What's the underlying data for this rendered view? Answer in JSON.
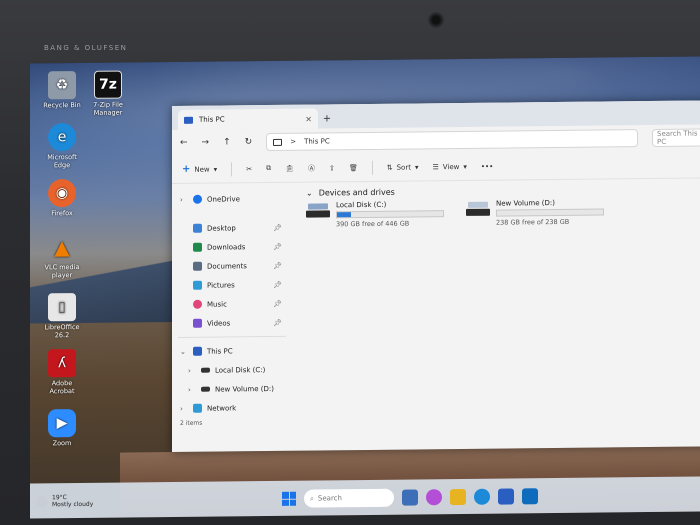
{
  "bezel": {
    "brand": "BANG & OLUFSEN"
  },
  "desktop_icons": [
    {
      "label": "Recycle Bin",
      "icon": "recycle-bin-icon",
      "color": "#8f9aa8"
    },
    {
      "label": "7-Zip File Manager",
      "icon": "7zip-icon",
      "color": "#111111"
    },
    {
      "label": "Microsoft Edge",
      "icon": "edge-icon",
      "color": "#1c8ad8"
    },
    {
      "label": "Firefox",
      "icon": "firefox-icon",
      "color": "#e8632c"
    },
    {
      "label": "VLC media player",
      "icon": "vlc-icon",
      "color": "#f07d00"
    },
    {
      "label": "LibreOffice 26.2",
      "icon": "libreoffice-icon",
      "color": "#e7e7e7"
    },
    {
      "label": "Adobe Acrobat",
      "icon": "acrobat-icon",
      "color": "#c4171d"
    },
    {
      "label": "Zoom",
      "icon": "zoom-icon",
      "color": "#2d8cff"
    }
  ],
  "explorer": {
    "tab_title": "This PC",
    "tab_close": "×",
    "new_tab": "+",
    "nav": {
      "back": "←",
      "forward": "→",
      "up": "↑",
      "refresh": "↻"
    },
    "address": {
      "chevron": ">",
      "location": "This PC"
    },
    "search_placeholder": "Search This PC",
    "commands": {
      "new": "New",
      "sort": "Sort",
      "view": "View",
      "more": "•••"
    },
    "sidebar": {
      "onedrive": "OneDrive",
      "quick_access": [
        {
          "label": "Desktop",
          "icon": "desktop-icon",
          "color": "#3b82d6"
        },
        {
          "label": "Downloads",
          "icon": "downloads-icon",
          "color": "#1f8a4c"
        },
        {
          "label": "Documents",
          "icon": "documents-icon",
          "color": "#5a6b84"
        },
        {
          "label": "Pictures",
          "icon": "pictures-icon",
          "color": "#2f9bd6"
        },
        {
          "label": "Music",
          "icon": "music-icon",
          "color": "#e0457b"
        },
        {
          "label": "Videos",
          "icon": "videos-icon",
          "color": "#7a4fd0"
        }
      ],
      "this_pc": "This PC",
      "this_pc_children": [
        {
          "label": "Local Disk (C:)"
        },
        {
          "label": "New Volume (D:)"
        }
      ],
      "network": "Network"
    },
    "section_title": "Devices and drives",
    "drives": [
      {
        "name": "Local Disk (C:)",
        "free_text": "390 GB free of 446 GB",
        "used_fraction": 0.13
      },
      {
        "name": "New Volume (D:)",
        "free_text": "238 GB free of 238 GB",
        "used_fraction": 0.0
      }
    ],
    "status": "2 items"
  },
  "taskbar": {
    "weather_temp": "19°C",
    "weather_desc": "Mostly cloudy",
    "search_placeholder": "Search",
    "apps": [
      {
        "icon": "widgets-icon",
        "color": "#3d6fb8"
      },
      {
        "icon": "copilot-icon",
        "color": "#b34fd6"
      },
      {
        "icon": "file-explorer-icon",
        "color": "#e8b321"
      },
      {
        "icon": "edge-icon",
        "color": "#1c8ad8"
      },
      {
        "icon": "store-icon",
        "color": "#2a5fc1"
      },
      {
        "icon": "outlook-icon",
        "color": "#0f6cbd"
      }
    ]
  }
}
